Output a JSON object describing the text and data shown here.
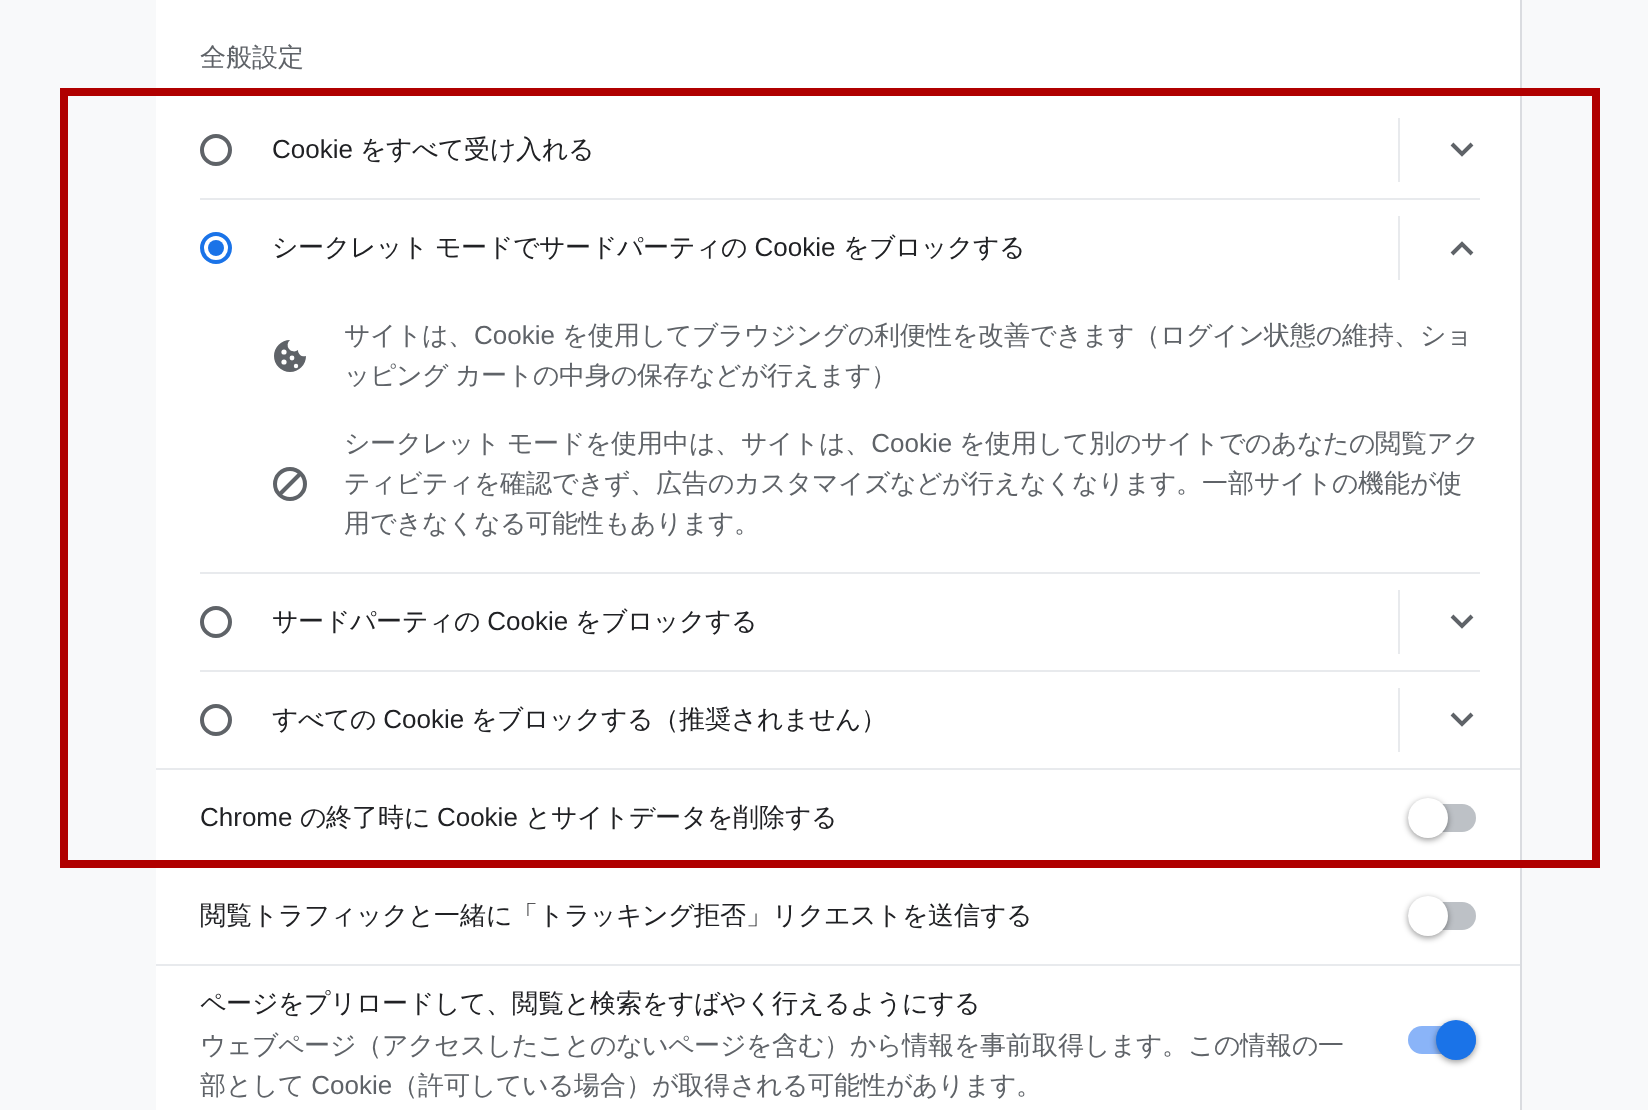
{
  "section_title": "全般設定",
  "cookie_options": [
    {
      "label": "Cookie をすべて受け入れる",
      "selected": false,
      "expanded": false
    },
    {
      "label": "シークレット モードでサードパーティの Cookie をブロックする",
      "selected": true,
      "expanded": true,
      "details": [
        {
          "kind": "cookie",
          "text": "サイトは、Cookie を使用してブラウジングの利便性を改善できます（ログイン状態の維持、ショッピング カートの中身の保存などが行えます）"
        },
        {
          "kind": "blocked",
          "text": "シークレット モードを使用中は、サイトは、Cookie を使用して別のサイトでのあなたの閲覧アクティビティを確認できず、広告のカスタマイズなどが行えなくなります。一部サイトの機能が使用できなくなる可能性もあります。"
        }
      ]
    },
    {
      "label": "サードパーティの Cookie をブロックする",
      "selected": false,
      "expanded": false
    },
    {
      "label": "すべての Cookie をブロックする（推奨されません）",
      "selected": false,
      "expanded": false
    }
  ],
  "toggles": [
    {
      "label": "Chrome の終了時に Cookie とサイトデータを削除する",
      "on": false
    },
    {
      "label": "閲覧トラフィックと一緒に「トラッキング拒否」リクエストを送信する",
      "on": false
    },
    {
      "label": "ページをプリロードして、閲覧と検索をすばやく行えるようにする",
      "description": "ウェブページ（アクセスしたことのないページを含む）から情報を事前取得します。この情報の一部として Cookie（許可している場合）が取得される可能性があります。",
      "on": true
    }
  ]
}
